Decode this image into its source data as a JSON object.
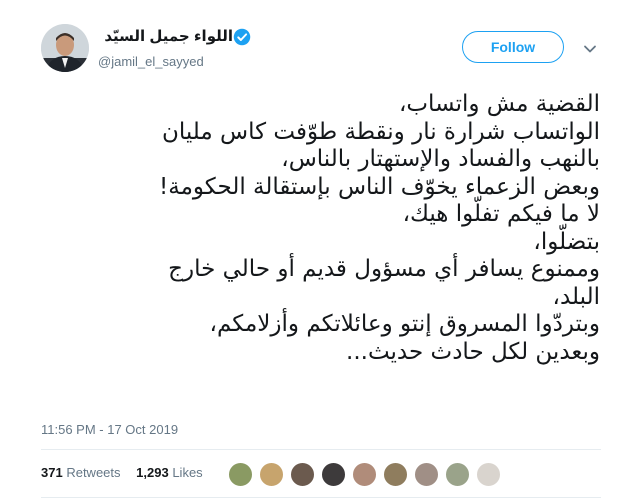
{
  "author": {
    "display_name": "اللواء جميل السيّد",
    "handle": "@jamil_el_sayyed",
    "verified": true,
    "avatar_icon": "profile-photo-icon"
  },
  "follow_label": "Follow",
  "tweet_lines": [
    "القضية مش واتساب،",
    "الواتساب شرارة نار ونقطة طوّفت كاس مليان",
    "بالنهب والفساد والإستهتار بالناس،",
    "وبعض الزعماء يخوّف الناس بإستقالة الحكومة!",
    "لا ما فيكم تفلّوا هيك،",
    "بتضلّوا،",
    "وممنوع يسافر أي مسؤول قديم أو حالي خارج",
    "البلد،",
    "وبتردّوا المسروق إنتو وعائلاتكم وأزلامكم،",
    "وبعدين لكل حادث حديث..."
  ],
  "timestamp": "11:56 PM - 17 Oct 2019",
  "stats": {
    "retweets_count": "371",
    "retweets_label": "Retweets",
    "likes_count": "1,293",
    "likes_label": "Likes"
  },
  "colors": {
    "accent": "#1da1f2",
    "secondary_text": "#657786",
    "divider": "#e6ecf0"
  }
}
